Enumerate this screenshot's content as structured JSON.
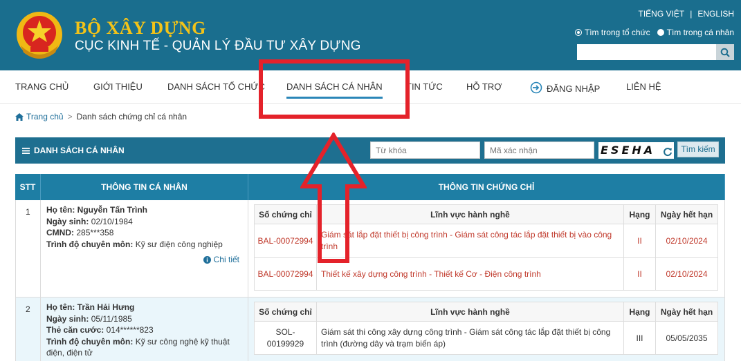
{
  "header": {
    "title": "BỘ XÂY DỰNG",
    "subtitle": "CỤC KINH TẾ - QUẢN LÝ ĐẦU TƯ XÂY DỰNG",
    "lang_vi": "TIẾNG VIỆT",
    "lang_sep": "|",
    "lang_en": "ENGLISH",
    "scope_org": "Tìm trong tổ chức",
    "scope_person": "Tìm trong cá nhân",
    "search_value": ""
  },
  "nav": {
    "home": "TRANG CHỦ",
    "about": "GIỚI THIỆU",
    "orgs": "DANH SÁCH TỔ CHỨC",
    "persons": "DANH SÁCH CÁ NHÂN",
    "news": "TIN TỨC",
    "support": "HỖ TRỢ",
    "login": "ĐĂNG NHẬP",
    "contact": "LIÊN HỆ"
  },
  "breadcrumb": {
    "home": "Trang chủ",
    "sep": ">",
    "current": "Danh sách chứng chỉ cá nhân"
  },
  "list": {
    "title": "DANH SÁCH CÁ NHÂN",
    "keyword_placeholder": "Từ khóa",
    "captcha_placeholder": "Mã xác nhận",
    "captcha_text": "ESEHA",
    "search_label": "Tìm kiếm"
  },
  "table": {
    "col_stt": "STT",
    "col_info": "THÔNG TIN CÁ NHÂN",
    "col_cert": "THÔNG TIN CHỨNG CHỈ",
    "sub_so": "Số chứng chỉ",
    "sub_lv": "Lĩnh vực hành nghề",
    "sub_hang": "Hạng",
    "sub_nh": "Ngày hết hạn",
    "detail_label": "Chi tiết",
    "rows": [
      {
        "stt": "1",
        "name_label": "Họ tên:",
        "name": "Nguyễn Tấn Trình",
        "dob_label": "Ngày sinh:",
        "dob": "02/10/1984",
        "id_label": "CMND:",
        "id": "285***358",
        "edu_label": "Trình độ chuyên môn:",
        "edu": "Kỹ sư điện công nghiệp",
        "certs": [
          {
            "so": "BAL-00072994",
            "lv": "Giám sát lắp đặt thiết bị công trình - Giám sát công tác lắp đặt thiết bị vào công trình",
            "hang": "II",
            "nh": "02/10/2024"
          },
          {
            "so": "BAL-00072994",
            "lv": "Thiết kế xây dựng công trình - Thiết kế Cơ - Điện công trình",
            "hang": "II",
            "nh": "02/10/2024"
          }
        ]
      },
      {
        "stt": "2",
        "name_label": "Họ tên:",
        "name": "Trần Hải Hưng",
        "dob_label": "Ngày sinh:",
        "dob": "05/11/1985",
        "id_label": "Thẻ căn cước:",
        "id": "014******823",
        "edu_label": "Trình độ chuyên môn:",
        "edu": "Kỹ sư công nghệ kỹ thuật điện, điện tử",
        "certs": [
          {
            "so": "SOL-00199929",
            "lv": "Giám sát thi công xây dựng công trình - Giám sát công tác lắp đặt thiết bị công trình (đường dây và trạm biến áp)",
            "hang": "III",
            "nh": "05/05/2035"
          }
        ]
      }
    ]
  },
  "colors": {
    "header_bg": "#1a6e8e",
    "brand_gold": "#f3c318",
    "accent": "#1e7ea4",
    "cert_red": "#c0392b",
    "overlay_red": "#e4222a"
  },
  "icons": [
    "national-emblem-icon",
    "search-icon",
    "login-icon",
    "home-icon",
    "menu-icon",
    "refresh-icon",
    "info-icon"
  ]
}
